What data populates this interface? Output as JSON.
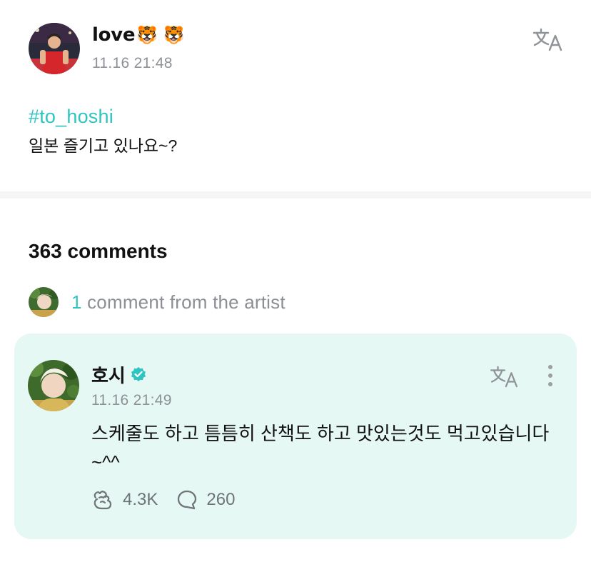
{
  "post": {
    "author_name": "love",
    "author_emoji": "🐯 🐯",
    "time": "11.16 21:48",
    "hashtag": "#to_hoshi",
    "text": "일본 즐기고 있나요~?"
  },
  "comments_section": {
    "count_label": "363 comments",
    "artist_comment_count": "1",
    "artist_comment_label": " comment from the artist"
  },
  "artist_comment": {
    "author_name": "호시",
    "time": "11.16 21:49",
    "text": "스케줄도 하고 틈틈히 산책도 하고 맛있는것도 먹고있습니다~^^",
    "likes": "4.3K",
    "replies": "260"
  },
  "colors": {
    "accent": "#2ec4c0",
    "card_background": "#e6f8f4",
    "muted_text": "#8d9196"
  },
  "icons": [
    "translate-icon",
    "verified-icon",
    "more-icon",
    "like-icon",
    "reply-icon"
  ]
}
